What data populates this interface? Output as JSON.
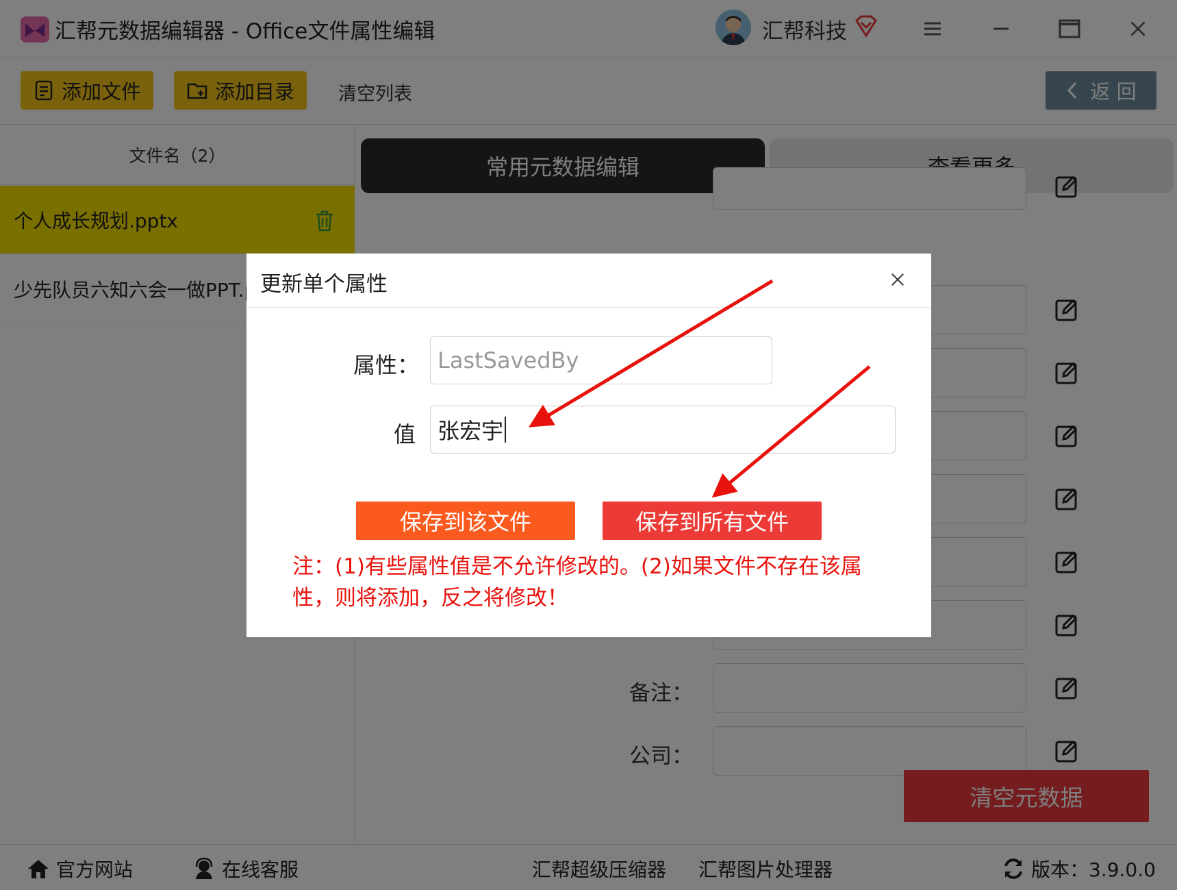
{
  "window": {
    "title": "汇帮元数据编辑器 - Office文件属性编辑",
    "user_name": "汇帮科技"
  },
  "toolbar": {
    "add_file": "添加文件",
    "add_folder": "添加目录",
    "clear_list": "清空列表",
    "back": "返 回"
  },
  "file_list": {
    "header": "文件名（2）",
    "files": [
      {
        "name": "个人成长规划.pptx",
        "selected": true
      },
      {
        "name": "少先队员六知六会一做PPT.pptx",
        "selected": false
      }
    ]
  },
  "tabs": {
    "common": "常用元数据编辑",
    "more": "查看更多"
  },
  "fields": {
    "remark_label": "备注：",
    "company_label": "公司："
  },
  "actions": {
    "clear_metadata": "清空元数据"
  },
  "dialog": {
    "title": "更新单个属性",
    "property_label": "属性：",
    "property_value": "LastSavedBy",
    "value_label": "值",
    "value_text": "张宏宇",
    "save_one": "保存到该文件",
    "save_all": "保存到所有文件",
    "note": "注：(1)有些属性值是不允许修改的。(2)如果文件不存在该属性，则将添加，反之将修改！"
  },
  "statusbar": {
    "website": "官方网站",
    "support": "在线客服",
    "compressor": "汇帮超级压缩器",
    "image_tool": "汇帮图片处理器",
    "version": "版本：3.9.0.0"
  },
  "colors": {
    "toolbar_button": "#f5c518",
    "selected_row": "#f5e000",
    "save_one_button": "#fb5a1f",
    "save_all_button": "#ec3b36",
    "note_text": "#e8120c",
    "arrow": "#e8120c"
  }
}
